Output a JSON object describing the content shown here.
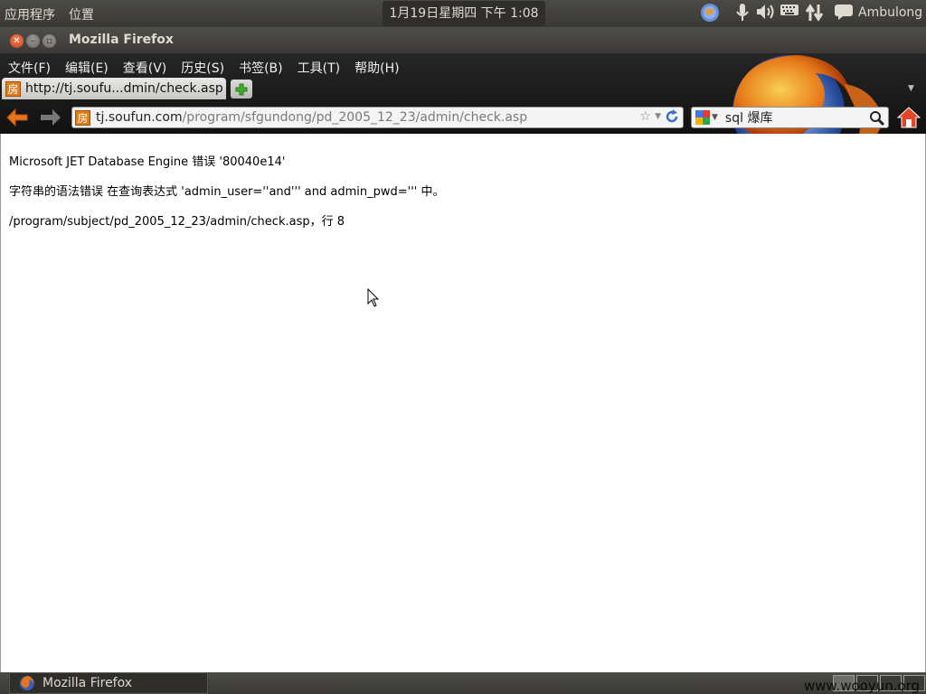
{
  "top_panel": {
    "menus": [
      "应用程序",
      "位置"
    ],
    "clock": "1月19日星期四 下午 1:08",
    "user": "Ambulong"
  },
  "window": {
    "title": "Mozilla Firefox"
  },
  "menubar": [
    "文件(F)",
    "编辑(E)",
    "查看(V)",
    "历史(S)",
    "书签(B)",
    "工具(T)",
    "帮助(H)"
  ],
  "tab": {
    "favicon": "房",
    "title": "http://tj.soufu...dmin/check.asp"
  },
  "urlbar": {
    "favicon": "房",
    "host": "tj.soufun.com",
    "path": "/program/sfgundong/pd_2005_12_23/admin/check.asp"
  },
  "searchbar": {
    "value": "sql 爆库"
  },
  "page": {
    "lines": [
      "Microsoft JET Database Engine 错误 '80040e14'",
      "字符串的语法错误 在查询表达式 'admin_user=''and''' and admin_pwd=''' 中。",
      "/program/subject/pd_2005_12_23/admin/check.asp，行 8"
    ]
  },
  "bottom_panel": {
    "task": "Mozilla Firefox",
    "watermark": "www.wooyun.org"
  },
  "colors": {
    "panel": "#3c3b37",
    "close_button": "#e35b2b",
    "content_bg": "#ffffff"
  }
}
